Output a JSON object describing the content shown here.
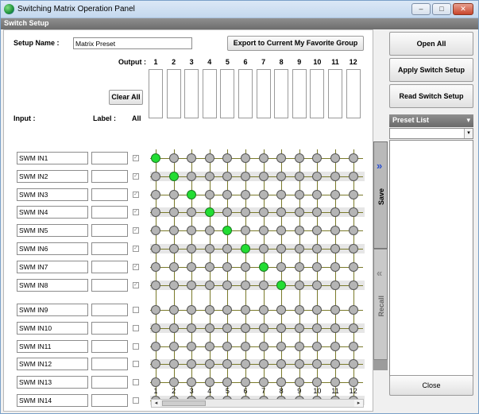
{
  "window": {
    "title": "Switching Matrix Operation Panel",
    "controls": [
      "–",
      "□",
      "✕"
    ]
  },
  "section": {
    "title": "Switch Setup"
  },
  "setup": {
    "name_label": "Setup Name :",
    "name_value": "Matrix Preset",
    "export_label": "Export to Current My Favorite Group"
  },
  "output": {
    "label": "Output :",
    "numbers": [
      "1",
      "2",
      "3",
      "4",
      "5",
      "6",
      "7",
      "8",
      "9",
      "10",
      "11",
      "12"
    ]
  },
  "clear_all_label": "Clear All",
  "columns": {
    "input": "Input :",
    "label": "Label :",
    "all": "All"
  },
  "inputs": [
    {
      "name": "SWM IN1",
      "label": "",
      "checked": true
    },
    {
      "name": "SWM IN2",
      "label": "",
      "checked": true
    },
    {
      "name": "SWM IN3",
      "label": "",
      "checked": true
    },
    {
      "name": "SWM IN4",
      "label": "",
      "checked": true
    },
    {
      "name": "SWM IN5",
      "label": "",
      "checked": true
    },
    {
      "name": "SWM IN6",
      "label": "",
      "checked": true
    },
    {
      "name": "SWM IN7",
      "label": "",
      "checked": true
    },
    {
      "name": "SWM IN8",
      "label": "",
      "checked": true
    },
    {
      "name": "SWM IN9",
      "label": "",
      "checked": false
    },
    {
      "name": "SWM IN10",
      "label": "",
      "checked": false
    },
    {
      "name": "SWM IN11",
      "label": "",
      "checked": false
    },
    {
      "name": "SWM IN12",
      "label": "",
      "checked": false
    },
    {
      "name": "SWM IN13",
      "label": "",
      "checked": false
    },
    {
      "name": "SWM IN14",
      "label": "",
      "checked": false
    }
  ],
  "matrix": {
    "active": [
      [
        1,
        1
      ],
      [
        2,
        2
      ],
      [
        3,
        3
      ],
      [
        4,
        4
      ],
      [
        5,
        5
      ],
      [
        6,
        6
      ],
      [
        7,
        7
      ],
      [
        8,
        8
      ]
    ],
    "on_color": "#22dd33",
    "off_color": "#b5b5b5"
  },
  "buttons": {
    "open_all": "Open All",
    "apply": "Apply Switch Setup",
    "read": "Read Switch Setup",
    "close": "Close"
  },
  "tabs": {
    "save": "Save",
    "recall": "Recall",
    "save_chevron": "»",
    "recall_chevron": "«"
  },
  "preset": {
    "header": "Preset List",
    "header_arrow": "▾",
    "combo_value": "",
    "combo_arrow": "▾"
  },
  "scrollbar": {
    "left_arrow": "◂",
    "right_arrow": "▸"
  },
  "accent": "#2a4fd0"
}
